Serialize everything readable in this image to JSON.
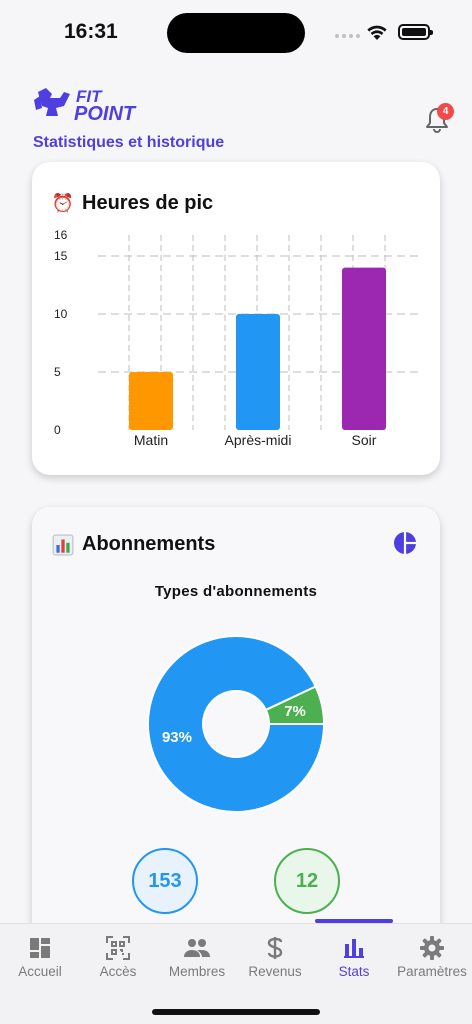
{
  "status_bar": {
    "time": "16:31"
  },
  "header": {
    "logo_top": "FIT",
    "logo_bottom": "POINT",
    "subtitle": "Statistiques et historique",
    "notification_count": "4"
  },
  "peak_hours": {
    "title": "Heures de pic",
    "icon": "alarm-clock-icon"
  },
  "subscriptions": {
    "title": "Abonnements",
    "icon": "bar-chart-icon",
    "pie_title": "Types d'abonnements",
    "stat_1": "153",
    "stat_2": "12"
  },
  "chart_data": [
    {
      "type": "bar",
      "categories": [
        "Matin",
        "Après-midi",
        "Soir"
      ],
      "values": [
        5,
        10,
        14
      ],
      "colors": [
        "#ff9800",
        "#2196f3",
        "#9c27b0"
      ],
      "yticks": [
        0,
        5,
        10,
        15,
        16
      ],
      "ylim": [
        0,
        16
      ],
      "grid": true
    },
    {
      "type": "pie",
      "labels": [
        "93%",
        "7%"
      ],
      "values": [
        93,
        7
      ],
      "colors": [
        "#2196f3",
        "#4caf50"
      ],
      "donut": true
    }
  ],
  "nav": {
    "items": [
      {
        "label": "Accueil",
        "icon": "dashboard-icon"
      },
      {
        "label": "Accès",
        "icon": "qr-code-icon"
      },
      {
        "label": "Membres",
        "icon": "people-icon"
      },
      {
        "label": "Revenus",
        "icon": "dollar-icon"
      },
      {
        "label": "Stats",
        "icon": "bar-chart-icon"
      },
      {
        "label": "Paramètres",
        "icon": "gear-icon"
      }
    ],
    "active": "Stats"
  }
}
